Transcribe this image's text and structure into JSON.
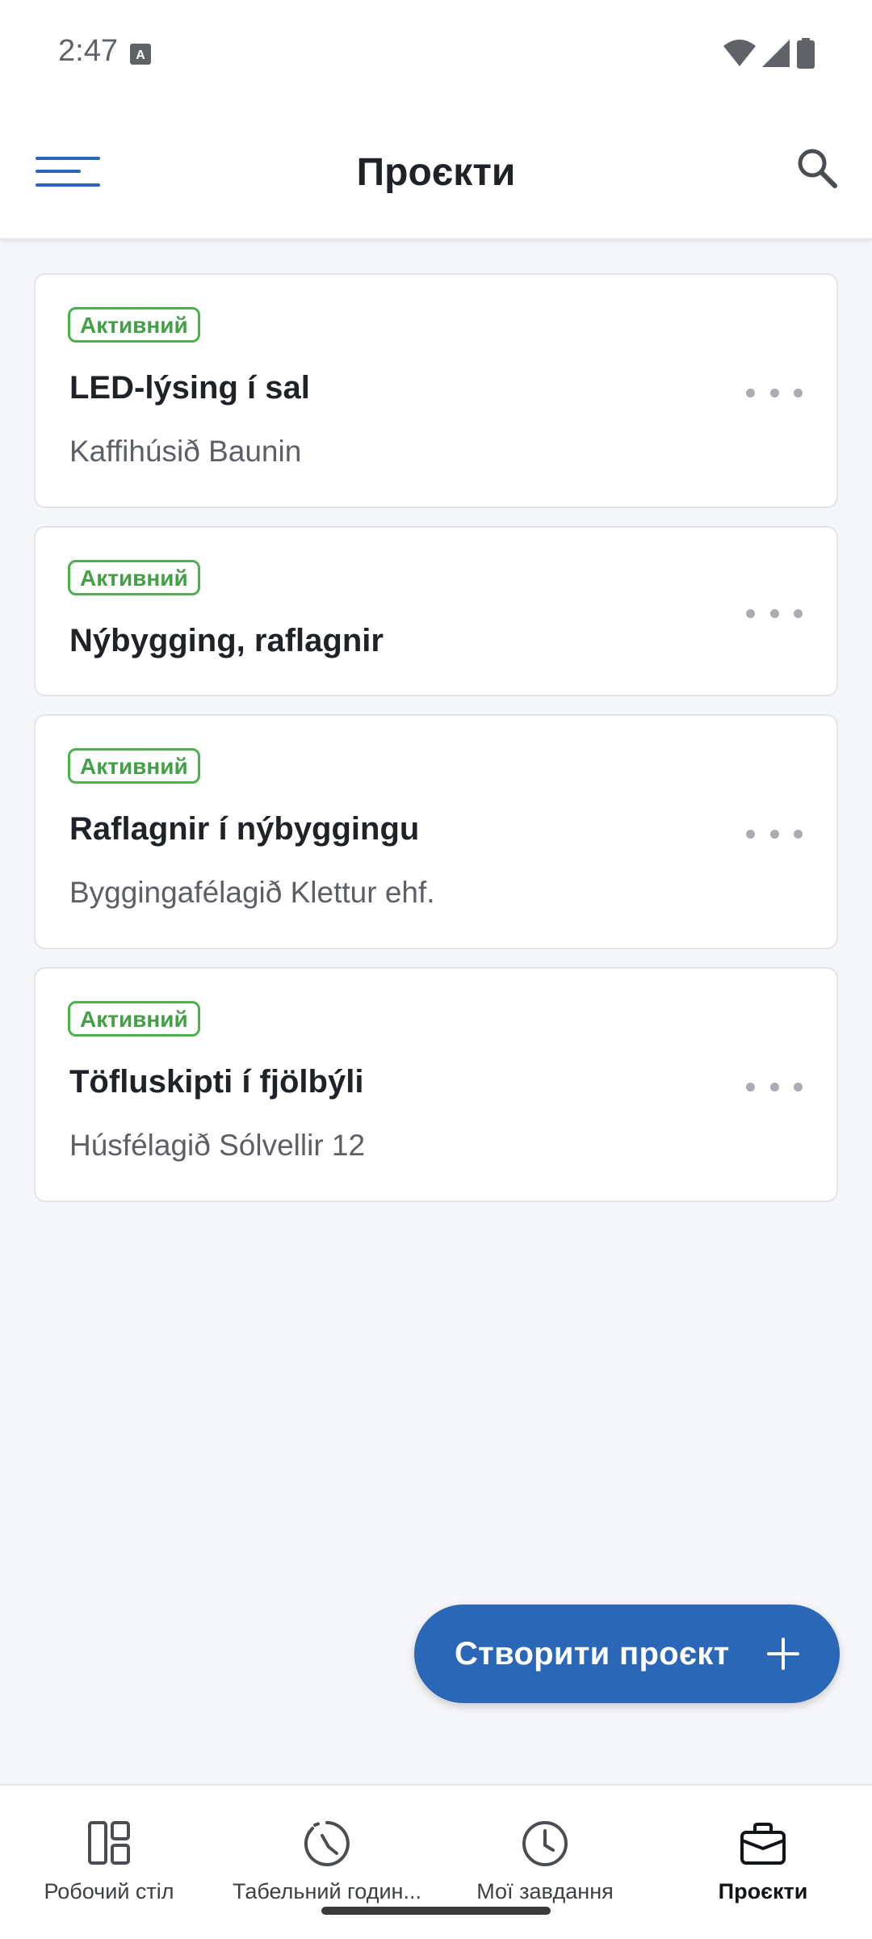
{
  "status_bar": {
    "time": "2:47",
    "icons": [
      "keyboard-a-icon",
      "wifi-icon",
      "signal-icon",
      "battery-icon"
    ]
  },
  "app_bar": {
    "title": "Проєкти",
    "menu_icon": "menu-icon",
    "search_icon": "search-icon",
    "accent": "#2a67b6"
  },
  "projects": [
    {
      "status": "Активний",
      "title": "LED-lýsing í sal",
      "client": "Kaffihúsið Baunin"
    },
    {
      "status": "Активний",
      "title": "Nýbygging, raflagnir",
      "client": ""
    },
    {
      "status": "Активний",
      "title": "Raflagnir í nýbyggingu",
      "client": "Byggingafélagið Klettur ehf."
    },
    {
      "status": "Активний",
      "title": "Töfluskipti í fjölbýli",
      "client": "Húsfélagið Sólvellir 12"
    }
  ],
  "status_color": "#43a047",
  "fab": {
    "label": "Створити проєкт",
    "icon": "plus-icon",
    "color": "#2a67b6"
  },
  "bottom_nav": {
    "items": [
      {
        "label": "Робочий стіл",
        "icon": "dashboard-icon",
        "active": false
      },
      {
        "label": "Табельний годин...",
        "icon": "timesheet-icon",
        "active": false
      },
      {
        "label": "Мої завдання",
        "icon": "clock-icon",
        "active": false
      },
      {
        "label": "Проєкти",
        "icon": "briefcase-icon",
        "active": true
      }
    ]
  }
}
